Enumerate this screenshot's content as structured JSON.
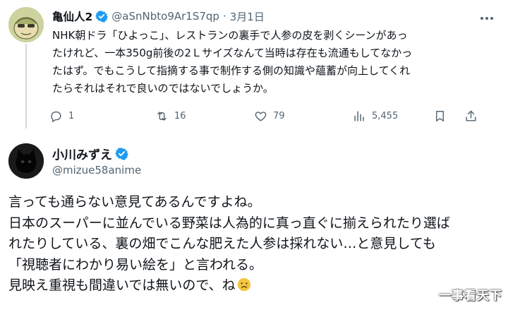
{
  "tweet1": {
    "display_name": "亀仙人2",
    "handle": "@aSnNbto9Ar1S7qp",
    "separator": "·",
    "time": "3月1日",
    "more_icon": "more-dots-icon",
    "text_lines": [
      "NHK朝ドラ「ひよっこ」、レストランの裏手で人参の皮を剥くシーンがあっ",
      "たけれど、一本350g前後の2Ｌサイズなんて当時は存在も流通もしてなかっ",
      "たはず。でもこうして指摘する事で制作する側の知識や蘊蓄が向上してくれ",
      "たらそれはそれで良いのではないでしょうか。"
    ],
    "actions": {
      "reply_count": "1",
      "retweet_count": "16",
      "like_count": "79",
      "views_count": "5,455"
    }
  },
  "tweet2": {
    "display_name": "小川みずえ",
    "handle": "@mizue58anime",
    "text_lines": [
      "言っても通らない意見てあるんですよね。",
      "日本のスーパーに並んでいる野菜は人為的に真っ直ぐに揃えられたり選ば",
      "れたりしている、裏の畑でこんな肥えた人参は採れない…と意見しても",
      "「視聴者にわかり易い絵を」と言われる。",
      "見映え重視も間違いでは無いので、ね"
    ]
  },
  "colors": {
    "verified": "#1d9bf0",
    "secondary_text": "#536471",
    "primary_text": "#0f1419",
    "thread_line": "#cfd9de"
  },
  "watermark": "一事看天下"
}
